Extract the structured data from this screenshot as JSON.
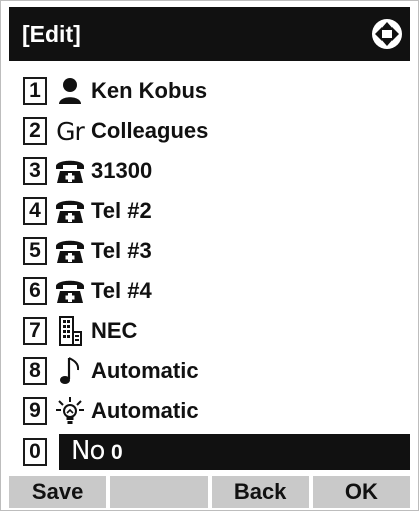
{
  "window": {
    "title": "[Edit]"
  },
  "items": [
    {
      "num": "1",
      "icon": "person-icon",
      "label": "Ken Kobus"
    },
    {
      "num": "2",
      "icon": "group-icon",
      "icon_text": "Gr",
      "label": "Colleagues"
    },
    {
      "num": "3",
      "icon": "telephone-icon",
      "label": "31300"
    },
    {
      "num": "4",
      "icon": "telephone-icon",
      "label": "Tel #2"
    },
    {
      "num": "5",
      "icon": "telephone-icon",
      "label": "Tel #3"
    },
    {
      "num": "6",
      "icon": "telephone-icon",
      "label": "Tel #4"
    },
    {
      "num": "7",
      "icon": "building-icon",
      "label": "NEC"
    },
    {
      "num": "8",
      "icon": "music-note-icon",
      "label": "Automatic"
    },
    {
      "num": "9",
      "icon": "lightbulb-icon",
      "label": "Automatic"
    }
  ],
  "selected": {
    "num": "0",
    "prefix": "No",
    "value": "0"
  },
  "softkeys": [
    "Save",
    "",
    "Back",
    "OK"
  ],
  "colors": {
    "titlebar": "#111111",
    "softkey": "#c9c9c9",
    "selected": "#111111"
  }
}
